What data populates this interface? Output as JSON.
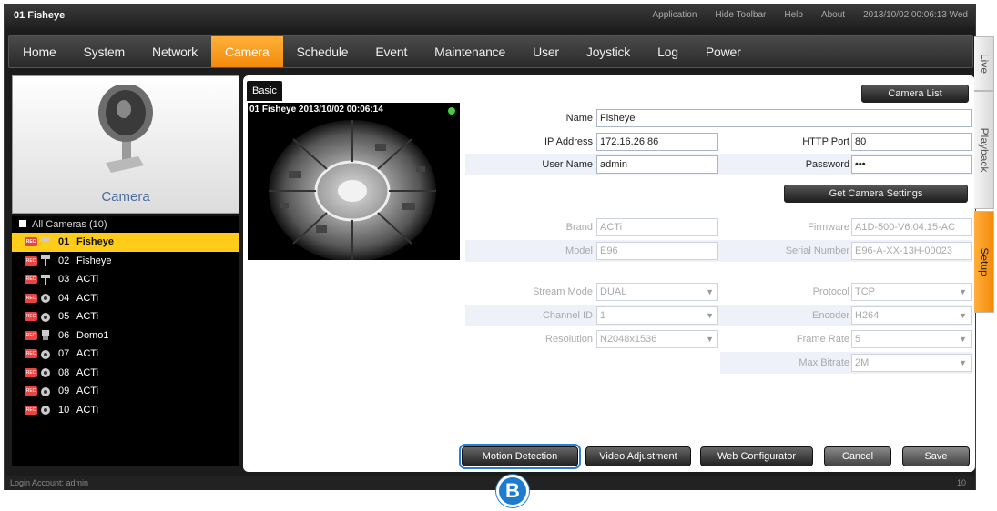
{
  "window": {
    "title": "01 Fisheye",
    "links": [
      "Application",
      "Hide Toolbar",
      "Help",
      "About",
      "2013/10/02 00:06:13 Wed"
    ]
  },
  "nav": {
    "items": [
      "Home",
      "System",
      "Network",
      "Camera",
      "Schedule",
      "Event",
      "Maintenance",
      "User",
      "Joystick",
      "Log",
      "Power"
    ],
    "active": "Camera"
  },
  "side_tabs": [
    "Live",
    "Playback",
    "Setup"
  ],
  "left_panel": {
    "camera_label": "Camera",
    "tree_root": "All Cameras (10)",
    "cameras": [
      {
        "num": "01",
        "name": "Fisheye",
        "icon": "fisheye-camera-icon",
        "selected": true
      },
      {
        "num": "02",
        "name": "Fisheye",
        "icon": "fisheye-camera-icon",
        "selected": false
      },
      {
        "num": "03",
        "name": "ACTi",
        "icon": "box-camera-icon",
        "selected": false
      },
      {
        "num": "04",
        "name": "ACTi",
        "icon": "dome-camera-icon",
        "selected": false
      },
      {
        "num": "05",
        "name": "ACTi",
        "icon": "dome-camera-icon",
        "selected": false
      },
      {
        "num": "06",
        "name": "Domo1",
        "icon": "ptz-camera-icon",
        "selected": false
      },
      {
        "num": "07",
        "name": "ACTi",
        "icon": "dome-camera-icon",
        "selected": false
      },
      {
        "num": "08",
        "name": "ACTi",
        "icon": "dome-camera-icon",
        "selected": false
      },
      {
        "num": "09",
        "name": "ACTi",
        "icon": "dome-camera-icon",
        "selected": false
      },
      {
        "num": "10",
        "name": "ACTi",
        "icon": "dome-camera-icon",
        "selected": false
      }
    ],
    "rec_label": "REC"
  },
  "content": {
    "tab": "Basic",
    "camera_list_button": "Camera List",
    "preview_osd": "01 Fisheye  2013/10/02 00:06:14",
    "form": {
      "name_label": "Name",
      "name_value": "Fisheye",
      "ip_label": "IP Address",
      "ip_value": "172.16.26.86",
      "http_port_label": "HTTP Port",
      "http_port_value": "80",
      "user_label": "User Name",
      "user_value": "admin",
      "password_label": "Password",
      "password_value": "•••",
      "get_settings_button": "Get Camera Settings",
      "brand_label": "Brand",
      "brand_value": "ACTi",
      "firmware_label": "Firmware",
      "firmware_value": "A1D-500-V6.04.15-AC",
      "model_label": "Model",
      "model_value": "E96",
      "serial_label": "Serial Number",
      "serial_value": "E96-A-XX-13H-00023",
      "stream_mode_label": "Stream Mode",
      "stream_mode_value": "DUAL",
      "protocol_label": "Protocol",
      "protocol_value": "TCP",
      "channel_label": "Channel ID",
      "channel_value": "1",
      "encoder_label": "Encoder",
      "encoder_value": "H264",
      "resolution_label": "Resolution",
      "resolution_value": "N2048x1536",
      "frame_rate_label": "Frame Rate",
      "frame_rate_value": "5",
      "max_bitrate_label": "Max Bitrate",
      "max_bitrate_value": "2M"
    },
    "buttons": {
      "motion_detection": "Motion Detection",
      "video_adjustment": "Video Adjustment",
      "web_configurator": "Web Configurator",
      "cancel": "Cancel",
      "save": "Save"
    }
  },
  "status": {
    "account": "Login Account: admin",
    "right": "10"
  },
  "callout": "B",
  "colors": {
    "accent": "#f7951d",
    "selected_row": "#ffcc1a",
    "callout": "#1d7ccf",
    "label_blue": "#4a6c9c"
  }
}
